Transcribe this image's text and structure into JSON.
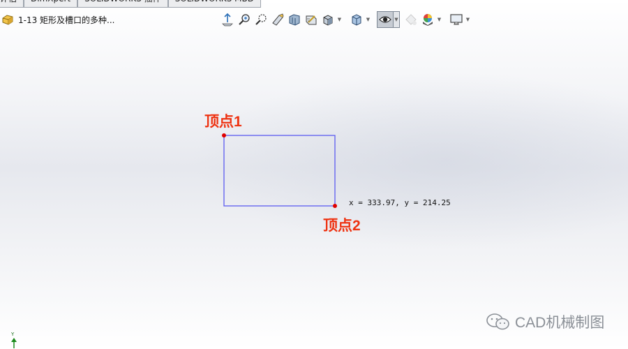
{
  "tabs": [
    {
      "label": "评估"
    },
    {
      "label": "DimXpert"
    },
    {
      "label": "SOLIDWORKS 插件"
    },
    {
      "label": "SOLIDWORKS MBD"
    }
  ],
  "document": {
    "title": "1-13 矩形及槽口的多种..."
  },
  "toolbar_icons": [
    "zoom-to-fit-icon",
    "zoom-to-area-icon",
    "previous-view-icon",
    "section-view-icon",
    "dynamic-annotation-views-icon",
    "view-orientation-icon",
    "display-style-icon",
    "hide-show-items-icon",
    "edit-appearance-icon",
    "apply-scene-icon",
    "view-settings-icon"
  ],
  "sketch": {
    "vertex1_label": "顶点1",
    "vertex2_label": "顶点2",
    "cursor_coordinates": "x = 333.97, y = 214.25",
    "line_color": "#5b5bf0",
    "point_color": "#e00000"
  },
  "triad": {
    "axis_label": "Y"
  },
  "watermark": {
    "text": "CAD机械制图"
  }
}
